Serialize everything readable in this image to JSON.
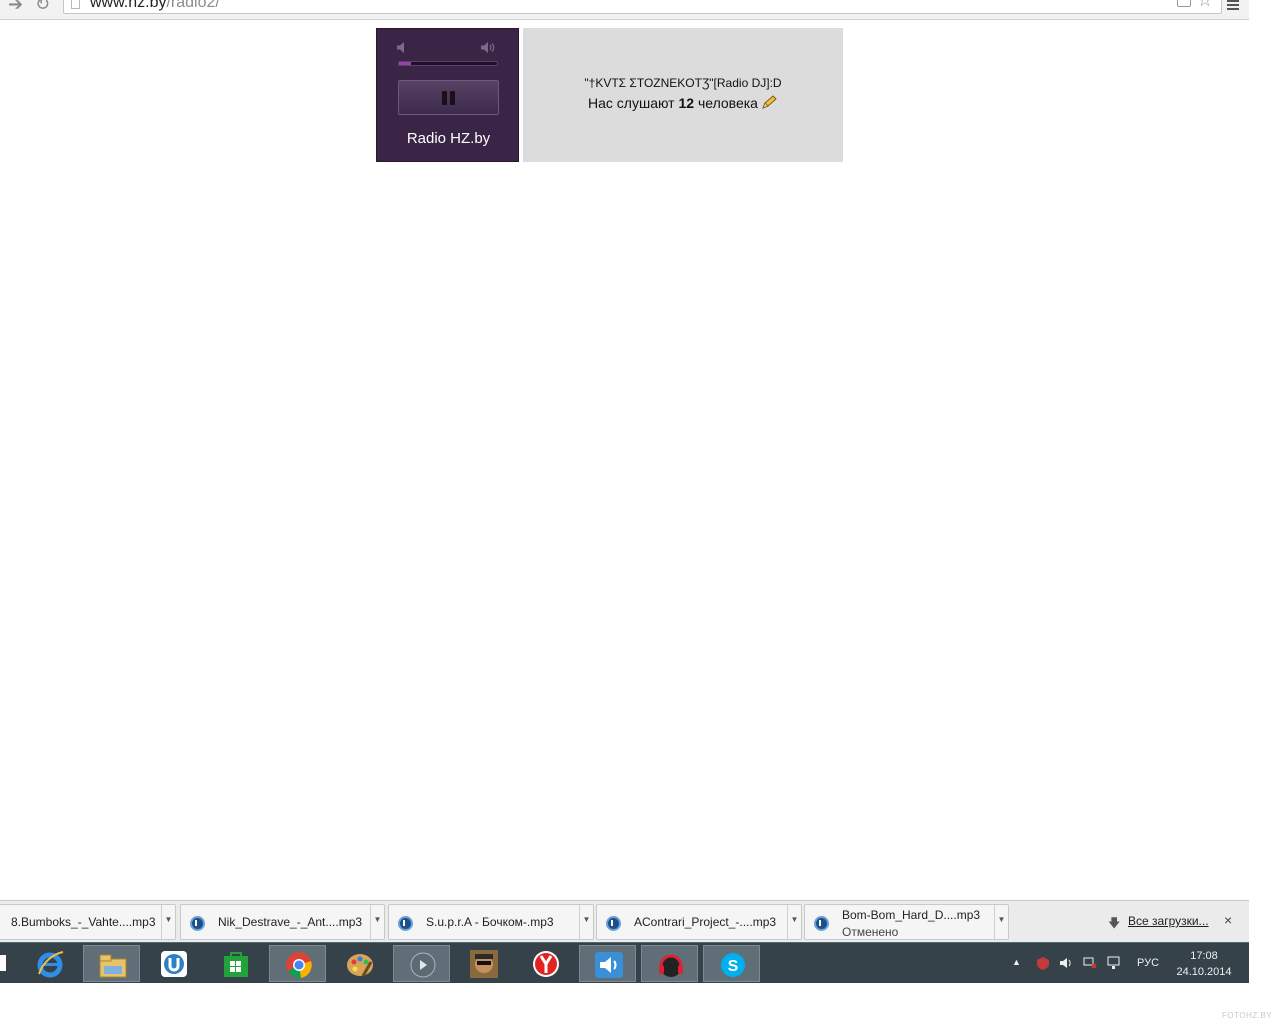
{
  "browser": {
    "url_host": "www.hz.by",
    "url_path": "/radio2/"
  },
  "player": {
    "station_name": "Radio HZ.by",
    "volume_fraction": 0.12
  },
  "now_playing": {
    "track_title": "\"†KVTΣ ΣTOZNEKOTƷ\"[Radio DJ]:D",
    "listeners_prefix": "Нас слушают",
    "listeners_count": "12",
    "listeners_suffix": "человека"
  },
  "downloads": {
    "items": [
      {
        "name": "8.Bumboks_-_Vahte....mp3",
        "status": ""
      },
      {
        "name": "Nik_Destrave_-_Ant....mp3",
        "status": ""
      },
      {
        "name": "S.u.p.r.A - Бочком-.mp3",
        "status": ""
      },
      {
        "name": "AContrari_Project_-....mp3",
        "status": ""
      },
      {
        "name": "Bom-Bom_Hard_D....mp3",
        "status": "Отменено"
      }
    ],
    "all_downloads_label": "Все загрузки...",
    "close_label": "×"
  },
  "taskbar": {
    "apps": [
      {
        "name": "internet-explorer-icon"
      },
      {
        "name": "file-explorer-icon"
      },
      {
        "name": "utorrent-icon"
      },
      {
        "name": "windows-store-icon"
      },
      {
        "name": "chrome-icon"
      },
      {
        "name": "paint-icon"
      },
      {
        "name": "media-player-icon"
      },
      {
        "name": "game-icon"
      },
      {
        "name": "yandex-browser-icon"
      },
      {
        "name": "audio-app-icon"
      },
      {
        "name": "music-app-icon"
      },
      {
        "name": "skype-icon"
      }
    ],
    "language": "РУС",
    "time": "17:08",
    "date": "24.10.2014"
  },
  "watermark": "FOTOHZ.BY",
  "colors": {
    "player_bg": "#3b2546",
    "info_bg": "#dcdcdc",
    "taskbar_bg": "#35424a",
    "volume_fill": "#9c3fb3"
  }
}
